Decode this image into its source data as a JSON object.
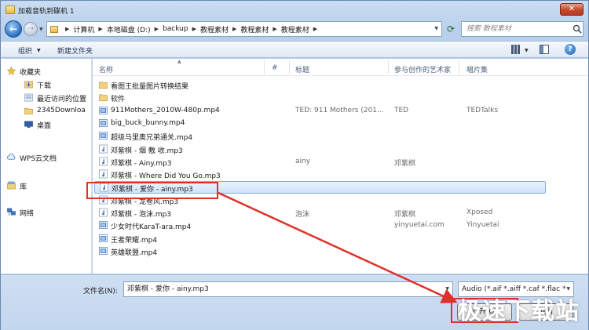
{
  "window": {
    "title": "加载音轨到碟机 1",
    "close_glyph": "✕"
  },
  "nav": {
    "back_glyph": "←",
    "forward_glyph": "→",
    "breadcrumbs": [
      "计算机",
      "本地磁盘 (D:)",
      "backup",
      "教程素材",
      "教程素材",
      "教程素材"
    ],
    "search_placeholder": "搜索 教程素材"
  },
  "toolbar": {
    "organize_label": "组织",
    "new_folder_label": "新建文件夹"
  },
  "sidebar": {
    "items": [
      {
        "label": "收藏夹",
        "icon": "star-icon"
      },
      {
        "label": "下载",
        "icon": "download-folder-icon"
      },
      {
        "label": "最近访问的位置",
        "icon": "recent-places-icon"
      },
      {
        "label": "2345Downloa",
        "icon": "folder-icon"
      },
      {
        "label": "桌面",
        "icon": "desktop-icon"
      },
      {
        "label": "WPS云文档",
        "icon": "cloud-icon"
      },
      {
        "label": "库",
        "icon": "library-icon"
      },
      {
        "label": "网络",
        "icon": "network-icon"
      }
    ]
  },
  "columns": {
    "name": "名称",
    "number": "#",
    "title": "标题",
    "artist": "参与创作的艺术家",
    "album": "唱片集"
  },
  "files": [
    {
      "name": "看图王批量图片转换结果",
      "type": "folder",
      "title": "",
      "artist": "",
      "album": ""
    },
    {
      "name": "软件",
      "type": "folder",
      "title": "",
      "artist": "",
      "album": ""
    },
    {
      "name": "911Mothers_2010W-480p.mp4",
      "type": "video",
      "title": "TED: 911 Mothers (201...",
      "artist": "TED",
      "album": "TEDTalks"
    },
    {
      "name": "big_buck_bunny.mp4",
      "type": "video",
      "title": "",
      "artist": "",
      "album": ""
    },
    {
      "name": "超级马里奥兄弟通关.mp4",
      "type": "video",
      "title": "",
      "artist": "",
      "album": ""
    },
    {
      "name": "邓紫棋 - 烟 敷 收.mp3",
      "type": "audio",
      "title": "",
      "artist": "",
      "album": ""
    },
    {
      "name": "邓紫棋 - Ainy.mp3",
      "type": "audio",
      "title": "ainy",
      "artist": "邓紫棋",
      "album": ""
    },
    {
      "name": "邓紫棋 - Where Did You Go.mp3",
      "type": "audio",
      "title": "",
      "artist": "",
      "album": ""
    },
    {
      "name": "邓紫棋 - 爱你 - ainy.mp3",
      "type": "audio",
      "title": "",
      "artist": "",
      "album": ""
    },
    {
      "name": "邓紫棋 - 龙卷风.mp3",
      "type": "audio",
      "title": "",
      "artist": "",
      "album": ""
    },
    {
      "name": "邓紫棋 - 泡沫.mp3",
      "type": "audio",
      "title": "泡沫",
      "artist": "邓紫棋",
      "album": "Xposed"
    },
    {
      "name": "少女时代KaraT-ara.mp4",
      "type": "video",
      "title": "",
      "artist": "yinyuetai.com",
      "album": "Yinyuetai"
    },
    {
      "name": "王者荣耀.mp4",
      "type": "video",
      "title": "",
      "artist": "",
      "album": ""
    },
    {
      "name": "英雄联盟.mp4",
      "type": "video",
      "title": "",
      "artist": "",
      "album": ""
    }
  ],
  "selected_index": 8,
  "bottom": {
    "filename_label": "文件名(N):",
    "filename_value": "邓紫棋 - 爱你 - ainy.mp3",
    "filetype_value": "Audio (*.aif *.aiff *.caf *.flac *",
    "open_label": "打开(O)",
    "cancel_label": "取消"
  },
  "watermark": "极速下载站",
  "colors": {
    "highlight": "#e0302a",
    "selection": "#cfe3fb",
    "chrome": "#b8d0ec"
  }
}
